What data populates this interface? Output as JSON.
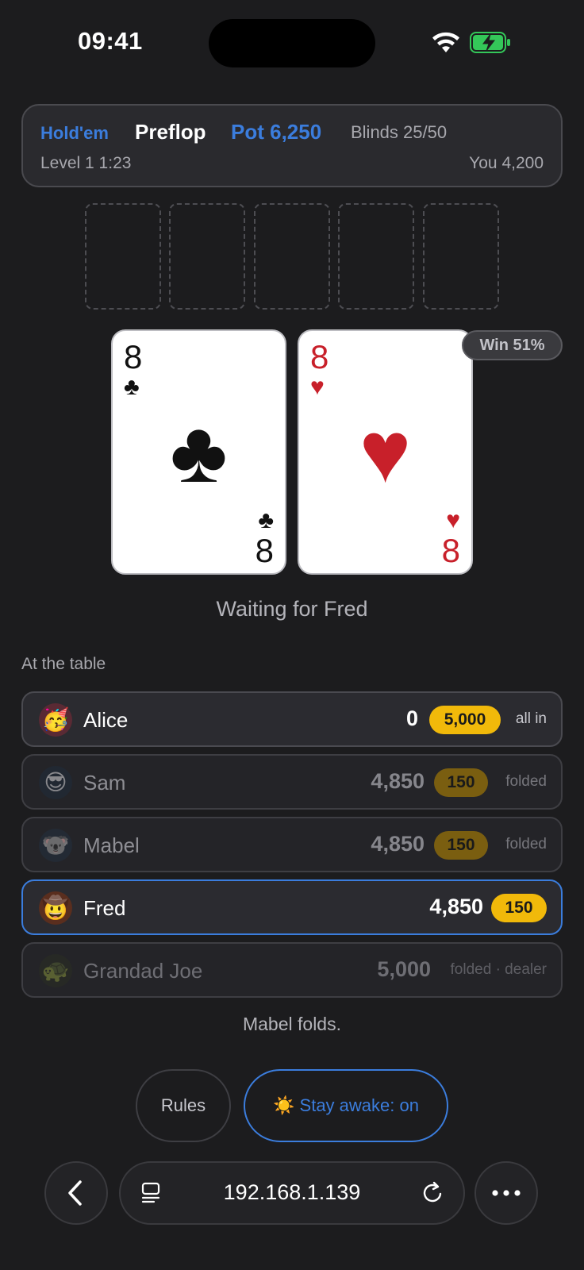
{
  "status_bar": {
    "time": "09:41"
  },
  "header": {
    "game": "Hold'em",
    "street": "Preflop",
    "pot": "Pot 6,250",
    "blinds": "Blinds 25/50",
    "level": "Level 1 1:23",
    "you": "You 4,200"
  },
  "board": {
    "slots": 5
  },
  "hole_cards": [
    {
      "rank": "8",
      "suit": "♣",
      "color": "#111111"
    },
    {
      "rank": "8",
      "suit": "♥",
      "color": "#c8202a"
    }
  ],
  "win_badge": "Win 51%",
  "waiting_text": "Waiting for Fred",
  "table_label": "At the table",
  "players": [
    {
      "avatar": "🥳",
      "avatar_name": "partying-face-icon",
      "name": "Alice",
      "stack": "0",
      "bet": "5,000",
      "status": "all in"
    },
    {
      "avatar": "😎",
      "avatar_name": "sunglasses-face-icon",
      "name": "Sam",
      "stack": "4,850",
      "bet": "150",
      "status": "folded"
    },
    {
      "avatar": "🐨",
      "avatar_name": "koala-icon",
      "name": "Mabel",
      "stack": "4,850",
      "bet": "150",
      "status": "folded"
    },
    {
      "avatar": "🤠",
      "avatar_name": "cowboy-face-icon",
      "name": "Fred",
      "stack": "4,850",
      "bet": "150",
      "status": ""
    },
    {
      "avatar": "🐢",
      "avatar_name": "turtle-icon",
      "name": "Grandad Joe",
      "stack": "5,000",
      "bet": "",
      "status": "folded · dealer"
    }
  ],
  "last_action": "Mabel folds.",
  "buttons": {
    "rules": "Rules",
    "stay_awake": "☀️ Stay awake: on"
  },
  "browser": {
    "url": "192.168.1.139"
  },
  "colors": {
    "accent": "#3b7ddd",
    "bet_chip": "#f1b90a",
    "background": "#1c1c1e"
  }
}
